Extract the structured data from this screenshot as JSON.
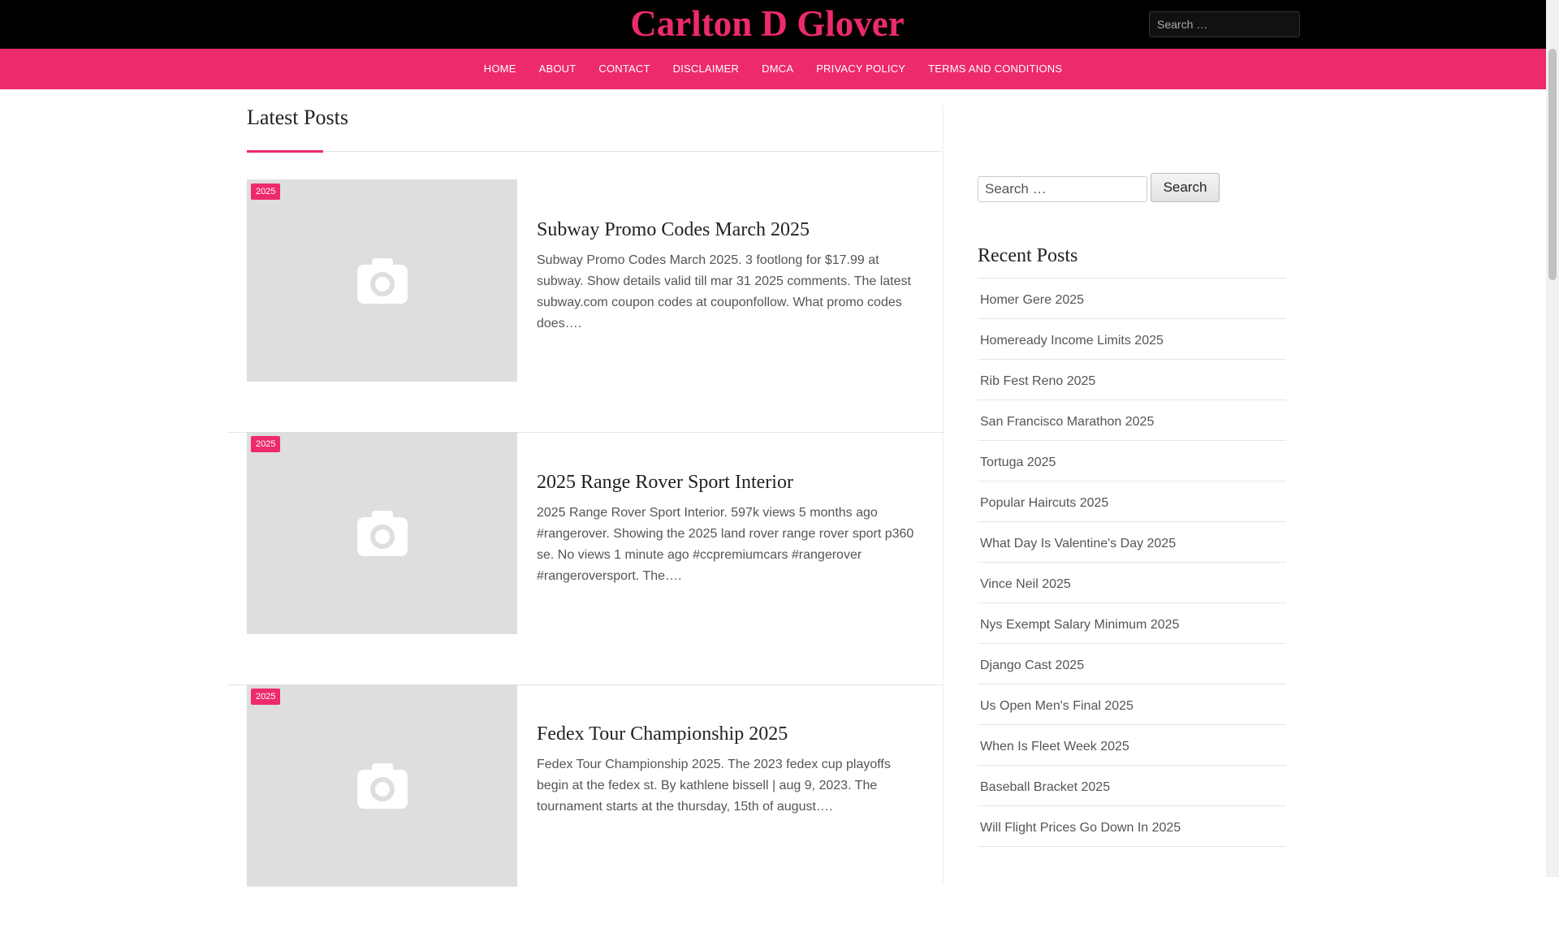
{
  "site": {
    "title": "Carlton D Glover"
  },
  "header_search": {
    "placeholder": "Search …"
  },
  "nav": [
    {
      "label": "HOME"
    },
    {
      "label": "ABOUT"
    },
    {
      "label": "CONTACT"
    },
    {
      "label": "DISCLAIMER"
    },
    {
      "label": "DMCA"
    },
    {
      "label": "PRIVACY POLICY"
    },
    {
      "label": "TERMS AND CONDITIONS"
    }
  ],
  "main": {
    "title": "Latest Posts",
    "posts": [
      {
        "badge": "2025",
        "title": "Subway Promo Codes March 2025",
        "excerpt": "Subway Promo Codes March 2025. 3 footlong for $17.99 at subway. Show details valid till mar 31 2025 comments. The latest subway.com coupon codes at couponfollow. What promo codes does….",
        "thumb_icon": "camera-icon"
      },
      {
        "badge": "2025",
        "title": "2025 Range Rover Sport Interior",
        "excerpt": "2025 Range Rover Sport Interior. 597k views 5 months ago #rangerover. Showing the 2025 land rover range rover sport p360 se. No views 1 minute ago #ccpremiumcars #rangerover #rangeroversport. The….",
        "thumb_icon": "camera-icon"
      },
      {
        "badge": "2025",
        "title": "Fedex Tour Championship 2025",
        "excerpt": "Fedex Tour Championship 2025. The 2023 fedex cup playoffs begin at the fedex st. By kathlene bissell | aug 9, 2023. The tournament starts at the thursday, 15th of august….",
        "thumb_icon": "camera-icon"
      }
    ]
  },
  "sidebar": {
    "search_placeholder": "Search …",
    "search_button": "Search",
    "recent_title": "Recent Posts",
    "recent": [
      "Homer Gere 2025",
      "Homeready Income Limits 2025",
      "Rib Fest Reno 2025",
      "San Francisco Marathon 2025",
      "Tortuga 2025",
      "Popular Haircuts 2025",
      "What Day Is Valentine's Day 2025",
      "Vince Neil 2025",
      "Nys Exempt Salary Minimum 2025",
      "Django Cast 2025",
      "Us Open Men's Final 2025",
      "When Is Fleet Week 2025",
      "Baseball Bracket 2025",
      "Will Flight Prices Go Down In 2025"
    ]
  },
  "colors": {
    "accent": "#ed2a6b",
    "header_bg": "#000000",
    "thumb_bg": "#dedede",
    "icon_color": "#ffffff"
  }
}
